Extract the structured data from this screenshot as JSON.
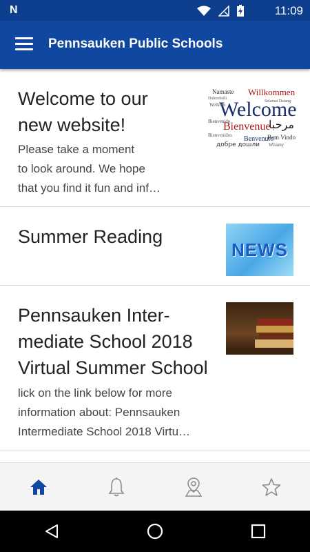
{
  "status_bar": {
    "time": "11:09"
  },
  "app_bar": {
    "title": "Pennsauken Public Schools"
  },
  "feed": [
    {
      "title_lines": [
        "Welcome to our",
        "new website!"
      ],
      "summary_lines": [
        "Please take a moment",
        "to look around. We hope",
        "that you find it fun and inf…"
      ],
      "thumbnail": "welcome-word-cloud",
      "thumb_words": [
        "Namaste",
        "Willkommen",
        "Welcome",
        "مرحبا",
        "Bienvenue",
        "Bienvenido",
        "Bem Vindo",
        "добре дошли",
        "Benvenuto",
        "Welkom",
        "Witamy",
        "Bienvenidos",
        "Selamat Datang",
        "Dobrodošli"
      ]
    },
    {
      "title_lines": [
        "Summer Reading"
      ],
      "summary_lines": [],
      "thumbnail": "news",
      "thumb_text": "NEWS"
    },
    {
      "title_lines": [
        "Pennsauken Inter-",
        "mediate School 2018",
        "Virtual Summer School"
      ],
      "summary_lines": [
        "lick on the link below for more",
        "information about: Pennsauken",
        "Intermediate School 2018 Virtu…"
      ],
      "thumbnail": "books"
    }
  ],
  "bottom_nav": {
    "items": [
      {
        "icon": "home-icon",
        "active": true
      },
      {
        "icon": "bell-icon",
        "active": false
      },
      {
        "icon": "map-pin-icon",
        "active": false
      },
      {
        "icon": "star-icon",
        "active": false
      }
    ],
    "active_color": "#0f47a1",
    "inactive_color": "#8a8a8a"
  },
  "colors": {
    "primary": "#0f47a1",
    "status_bar": "#0e3f8f"
  }
}
